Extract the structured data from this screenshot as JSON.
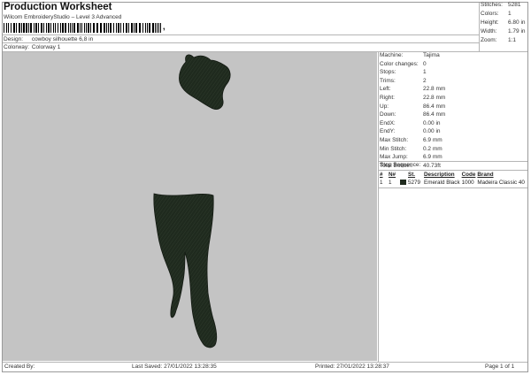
{
  "header": {
    "title": "Production Worksheet",
    "subtitle": "Wilcom EmbroideryStudio – Level 3 Advanced",
    "barcode_tail": ","
  },
  "info": {
    "design_label": "Design:",
    "design_value": "cowboy silhouette 6,8 in",
    "colorway_label": "Colorway:",
    "colorway_value": "Colorway 1"
  },
  "stats": [
    {
      "label": "Stitches:",
      "value": "5281"
    },
    {
      "label": "Colors:",
      "value": "1"
    },
    {
      "label": "Height:",
      "value": "6.80 in"
    },
    {
      "label": "Width:",
      "value": "1.79 in"
    },
    {
      "label": "Zoom:",
      "value": "1:1"
    }
  ],
  "properties": [
    {
      "label": "Machine:",
      "value": "Tajima"
    },
    {
      "label": "Color changes:",
      "value": "0"
    },
    {
      "label": "Stops:",
      "value": "1"
    },
    {
      "label": "Trims:",
      "value": "2"
    },
    {
      "label": "Left:",
      "value": "22.8 mm"
    },
    {
      "label": "Right:",
      "value": "22.8 mm"
    },
    {
      "label": "Up:",
      "value": "86.4 mm"
    },
    {
      "label": "Down:",
      "value": "86.4 mm"
    },
    {
      "label": "EndX:",
      "value": "0.00 in"
    },
    {
      "label": "EndY:",
      "value": "0.00 in"
    },
    {
      "label": "Max Stitch:",
      "value": "6.9 mm"
    },
    {
      "label": "Min Stitch:",
      "value": "0.2 mm"
    },
    {
      "label": "Max Jump:",
      "value": "6.9 mm"
    },
    {
      "label": "Total Bobbin:",
      "value": "40.73ft"
    }
  ],
  "stop_sequence": {
    "title": "Stop Sequence:",
    "headers": [
      "#",
      "N#",
      "",
      "St.",
      "Description",
      "Code",
      "Brand"
    ],
    "rows": [
      {
        "num": "1",
        "n": "1",
        "st": "5279",
        "description": "Emerald Black",
        "code": "1000",
        "brand": "Madeira Classic 40",
        "color": "#1f2a1e"
      }
    ]
  },
  "design_colors": {
    "canvas_background": "#c4c4c4",
    "thread": "#1f2a1e"
  },
  "footer": {
    "created_by": "Created By:",
    "last_saved": "Last Saved: 27/01/2022 13:28:35",
    "printed": "Printed: 27/01/2022 13:28:37",
    "page": "Page 1 of 1"
  }
}
